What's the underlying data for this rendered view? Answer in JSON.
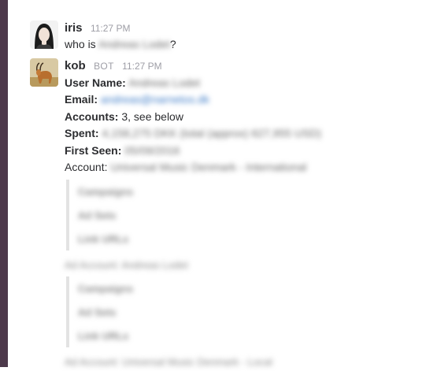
{
  "messages": [
    {
      "author": "iris",
      "time": "11:27 PM",
      "text_prefix": "who is",
      "text_hidden": "Andreas Lodet",
      "text_suffix": "?"
    },
    {
      "author": "kob",
      "bot_tag": "BOT",
      "time": "11:27 PM",
      "fields": {
        "user_name_label": "User Name:",
        "user_name_value": "Andreas Lodet",
        "email_label": "Email:",
        "email_value": "andreas@narnetos.dk",
        "accounts_label": "Accounts:",
        "accounts_value": "3, see below",
        "spent_label": "Spent:",
        "spent_value": "4,158,275 DKK (total (approx) 627,955 USD)",
        "first_seen_label": "First Seen:",
        "first_seen_value": "05/09/2016",
        "account_label": "Account:",
        "account_value": "Universal Music Denmark - International"
      },
      "accounts": [
        {
          "title": "",
          "items": [
            "Campaigns",
            "Ad Sets",
            "Link URLs"
          ]
        },
        {
          "title": "Ad Account: Andreas Lodet",
          "items": [
            "Campaigns",
            "Ad Sets",
            "Link URLs"
          ]
        },
        {
          "title": "Ad Account: Universal Music Denmark - Local",
          "items": []
        }
      ]
    }
  ]
}
